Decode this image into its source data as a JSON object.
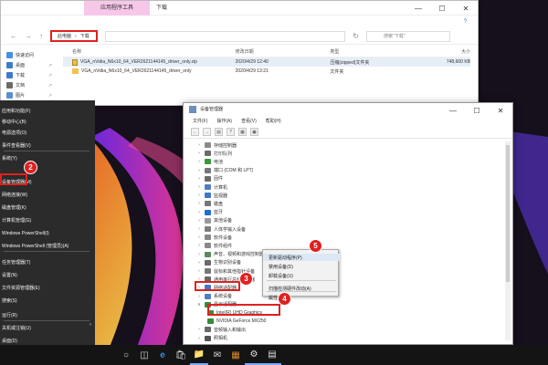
{
  "explorer": {
    "context_tab": "应用程序工具",
    "title": "下载",
    "address_segments": [
      "此电脑",
      "下载"
    ],
    "search_placeholder": "搜索\"下载\"",
    "columns": {
      "name": "名称",
      "date": "修改日期",
      "type": "类型",
      "size": "大小"
    },
    "sidebar": [
      {
        "label": "快速访问",
        "color": "#4a90e2"
      },
      {
        "label": "桌面",
        "color": "#3d7cc9"
      },
      {
        "label": "下载",
        "color": "#3d7cc9"
      },
      {
        "label": "文档",
        "color": "#6b6b6b"
      },
      {
        "label": "图片",
        "color": "#5a8fcf"
      },
      {
        "label": "视频",
        "color": "#5a8fcf"
      }
    ],
    "files": [
      {
        "name": "VGA_nVidia_N6x10_64_VER2621144145_driver_only.zip",
        "date": "2020/4/29 12:40",
        "type": "压缩(zipped)文件夹",
        "size": "748,600 KB",
        "icon": "zip",
        "selected": true
      },
      {
        "name": "VGA_nVidia_N6x10_64_VER2621144145_driver_only",
        "date": "2020/4/29 13:21",
        "type": "文件夹",
        "size": "",
        "icon": "folder",
        "selected": false
      }
    ]
  },
  "winx_menu": {
    "items": [
      "应用和功能(F)",
      "移动中心(B)",
      "电源选项(O)",
      "事件查看器(V)",
      "系统(Y)",
      "设备管理器(M)",
      "网络连接(W)",
      "磁盘管理(K)",
      "计算机管理(G)",
      "Windows PowerShell(I)",
      "Windows PowerShell (管理员)(A)",
      "任务管理器(T)",
      "设置(N)",
      "文件资源管理器(E)",
      "搜索(S)",
      "运行(R)",
      "关机或注销(U)",
      "桌面(D)"
    ]
  },
  "devmgr": {
    "title": "设备管理器",
    "menu": [
      "文件(F)",
      "操作(A)",
      "查看(V)",
      "帮助(H)"
    ],
    "tree": [
      {
        "label": "存储控制器",
        "expanded": false,
        "color": "#8a8a8a"
      },
      {
        "label": "打印队列",
        "expanded": false,
        "color": "#6c6c6c"
      },
      {
        "label": "电池",
        "expanded": false,
        "color": "#3a9a3a"
      },
      {
        "label": "端口 (COM 和 LPT)",
        "expanded": false,
        "color": "#777777"
      },
      {
        "label": "固件",
        "expanded": false,
        "color": "#6b6b6b"
      },
      {
        "label": "计算机",
        "expanded": false,
        "color": "#4d7fc2"
      },
      {
        "label": "监视器",
        "expanded": false,
        "color": "#3f79c5"
      },
      {
        "label": "键盘",
        "expanded": false,
        "color": "#777777"
      },
      {
        "label": "蓝牙",
        "expanded": false,
        "color": "#1f6fd1"
      },
      {
        "label": "其他设备",
        "expanded": false,
        "color": "#999999"
      },
      {
        "label": "人体学输入设备",
        "expanded": false,
        "color": "#7d7d7d"
      },
      {
        "label": "软件设备",
        "expanded": false,
        "color": "#888888"
      },
      {
        "label": "软件组件",
        "expanded": false,
        "color": "#888888"
      },
      {
        "label": "声音、视频和游戏控制器",
        "expanded": false,
        "color": "#5a8a5a"
      },
      {
        "label": "生物识别设备",
        "expanded": false,
        "color": "#6a6a6a"
      },
      {
        "label": "鼠标和其他指针设备",
        "expanded": false,
        "color": "#777777"
      },
      {
        "label": "通用串行总线控制器",
        "expanded": false,
        "color": "#666666"
      },
      {
        "label": "网络适配器",
        "expanded": false,
        "color": "#3f79c5"
      },
      {
        "label": "系统设备",
        "expanded": false,
        "color": "#4d7fc2"
      },
      {
        "label": "显示适配器",
        "expanded": true,
        "color": "#3a8a3a"
      },
      {
        "label": "Intel(R) UHD Graphics",
        "expanded": null,
        "child": true,
        "color": "#3a8a3a"
      },
      {
        "label": "NVIDIA GeForce MX250",
        "expanded": null,
        "child": true,
        "color": "#3a8a3a"
      },
      {
        "label": "音频输入和输出",
        "expanded": false,
        "color": "#6a6a6a"
      },
      {
        "label": "照相机",
        "expanded": false,
        "color": "#555555"
      }
    ]
  },
  "context_menu": {
    "items": [
      "更新驱动程序(P)",
      "禁用设备(D)",
      "卸载设备(U)",
      "扫描检测硬件改动(A)",
      "属性(R)"
    ]
  },
  "badges": [
    "2",
    "3",
    "4",
    "5"
  ],
  "taskbar": {
    "icons": [
      "start-icon",
      "search-icon",
      "task-view-icon",
      "edge-icon",
      "store-icon",
      "file-explorer-icon",
      "mail-icon",
      "app-icon",
      "settings-icon",
      "device-manager-icon"
    ]
  }
}
